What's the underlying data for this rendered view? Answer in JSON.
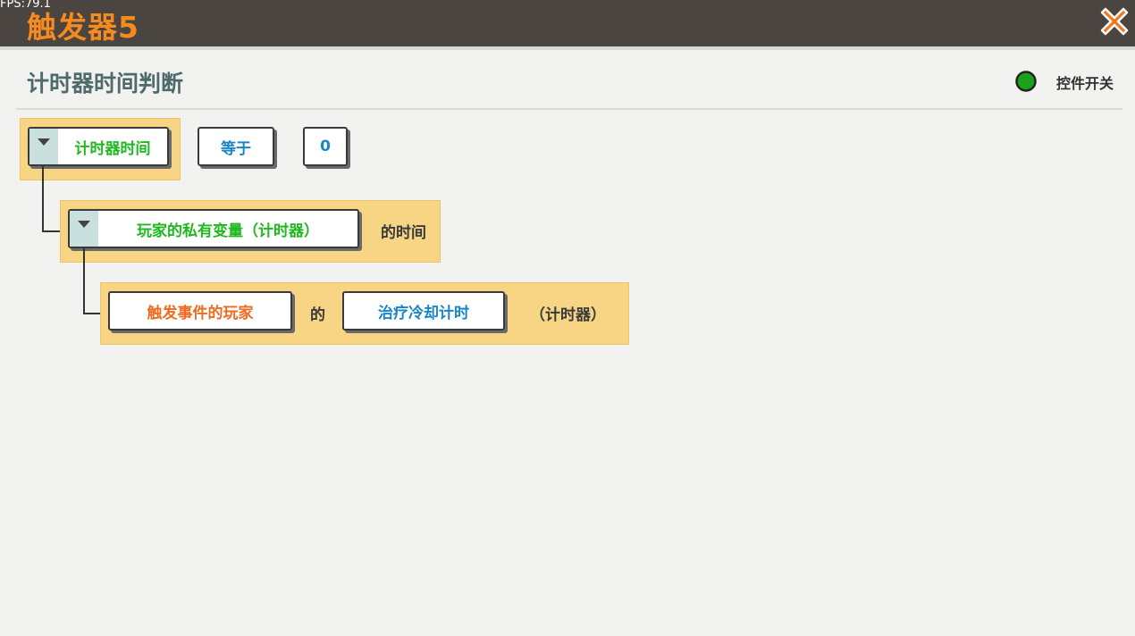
{
  "window": {
    "fps": "FPS:79.1",
    "title": "触发器5",
    "close_icon": "close-x-icon"
  },
  "panel": {
    "title": "计时器时间判断",
    "toggle_label": "控件开关",
    "toggle_color": "#1aa31a"
  },
  "condition": {
    "left_dropdown": "计时器时间",
    "operator": "等于",
    "value": "0"
  },
  "level1": {
    "dropdown": "玩家的私有变量（计时器）",
    "suffix": "的时间"
  },
  "level2": {
    "player": "触发事件的玩家",
    "connector_text": "的",
    "variable": "治疗冷却计时",
    "suffix": "（计时器）"
  },
  "colors": {
    "accent_orange": "#f58a1f",
    "frame": "#f7d584",
    "green_text": "#1fb81f",
    "blue_text": "#1a84c8",
    "orange_text": "#ee6a1f"
  }
}
